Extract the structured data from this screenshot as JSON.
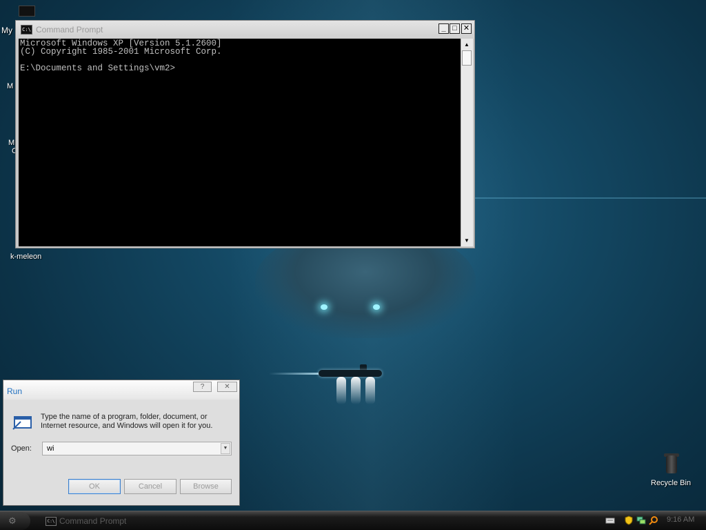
{
  "desktop": {
    "icons": [
      {
        "label": "My"
      },
      {
        "label": "M"
      },
      {
        "label": "M"
      },
      {
        "label": "C"
      },
      {
        "label": "k-meleon"
      },
      {
        "label": "Recycle Bin"
      }
    ]
  },
  "cmd_window": {
    "title": "Command Prompt",
    "icon_text": "C:\\",
    "minimize": "_",
    "maximize": "□",
    "close": "✕",
    "lines": [
      "Microsoft Windows XP [Version 5.1.2600]",
      "(C) Copyright 1985-2001 Microsoft Corp.",
      "",
      "E:\\Documents and Settings\\vm2>"
    ],
    "scroll_up": "▲",
    "scroll_down": "▼"
  },
  "run_dialog": {
    "title": "Run",
    "help": "?",
    "close": "✕",
    "description": "Type the name of a program, folder, document, or Internet resource, and Windows will open it for you.",
    "open_label": "Open:",
    "open_value": "wi",
    "combo_arrow": "▼",
    "ok": "OK",
    "cancel": "Cancel",
    "browse": "Browse"
  },
  "taskbar": {
    "start_glyph": "⚙",
    "task_icon_text": "C:\\",
    "task_label": "Command Prompt",
    "tray_icons": [
      "keyboard-icon",
      "shield-icon",
      "network-icon",
      "search-icon"
    ],
    "clock": "9:16 AM"
  }
}
